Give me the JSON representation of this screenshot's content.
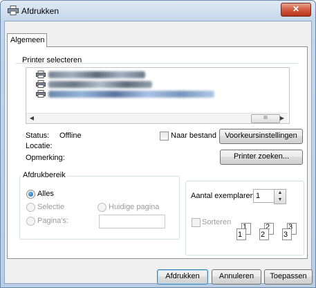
{
  "window": {
    "title": "Afdrukken",
    "close_glyph": "✕"
  },
  "tabs": [
    {
      "label": "Algemeen"
    }
  ],
  "printer_group": {
    "legend": "Printer selecteren",
    "scroll_thumb": "III",
    "status_label": "Status:",
    "status_value": "Offline",
    "location_label": "Locatie:",
    "comment_label": "Opmerking:",
    "print_to_file_label": "Naar bestand",
    "preferences_button": "Voorkeursinstellingen",
    "find_printer_button": "Printer zoeken..."
  },
  "range_group": {
    "legend": "Afdrukbereik",
    "all_label": "Alles",
    "selection_label": "Selectie",
    "current_page_label": "Huidige pagina",
    "pages_label": "Pagina's:",
    "pages_value": ""
  },
  "copies_group": {
    "copies_label": "Aantal exemplaren:",
    "copies_value": "1",
    "collate_label": "Sorteren",
    "page_digits": [
      "1",
      "1",
      "2",
      "2",
      "3",
      "3"
    ]
  },
  "buttons": {
    "print": "Afdrukken",
    "cancel": "Annuleren",
    "apply": "Toepassen"
  },
  "colors": {
    "title_gradient": "#dfe9f5",
    "close_red": "#cf5a3e",
    "focus_blue": "#3c7fb1"
  },
  "icons": [
    "printer-icon",
    "close-icon",
    "scroll-left-icon",
    "scroll-right-icon",
    "spin-up-icon",
    "spin-down-icon"
  ]
}
